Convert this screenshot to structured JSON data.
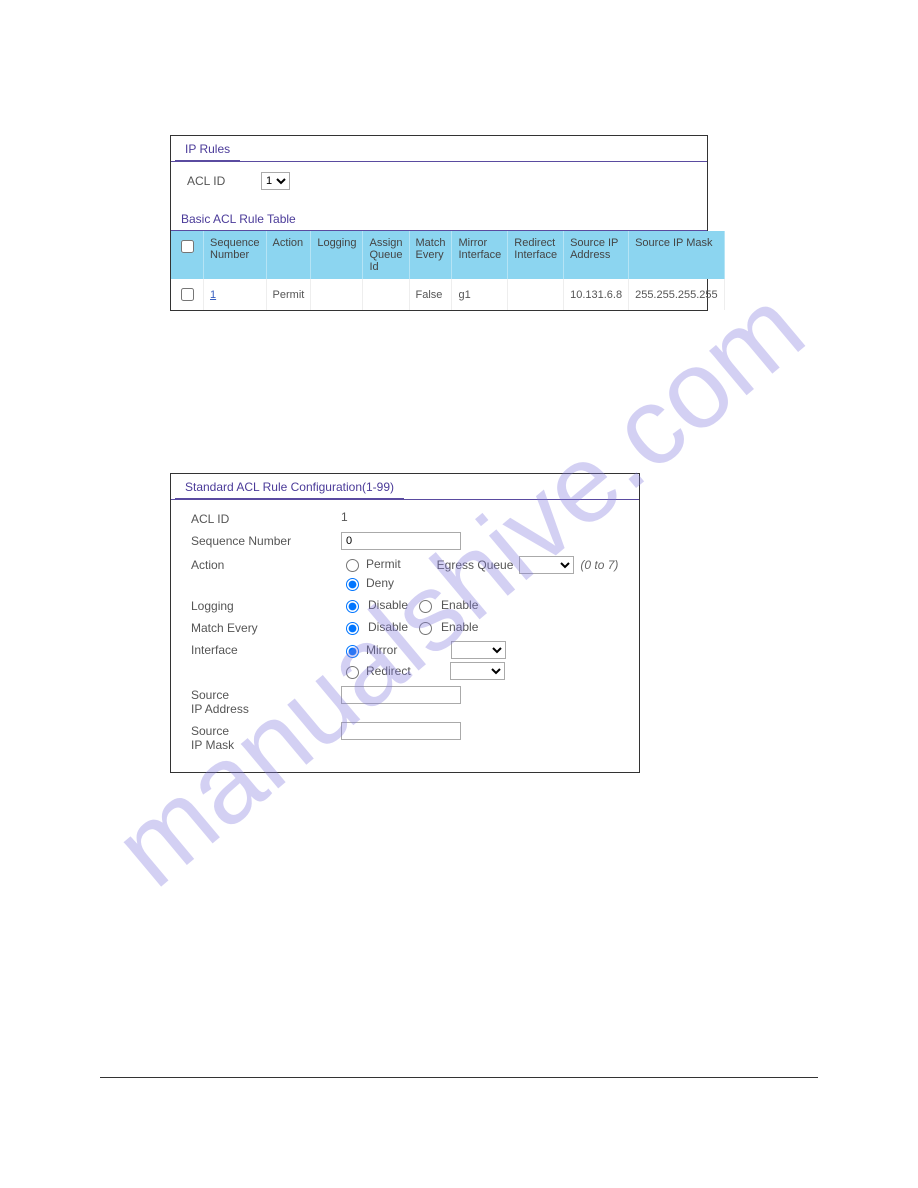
{
  "watermark": "manualshive.com",
  "panel1": {
    "title": "IP Rules",
    "acl_id_label": "ACL ID",
    "acl_id_value": "1",
    "subtitle": "Basic ACL Rule Table",
    "headers": {
      "seq": "Sequence Number",
      "action": "Action",
      "logging": "Logging",
      "assign": "Assign Queue Id",
      "match": "Match Every",
      "mirror": "Mirror Interface",
      "redirect": "Redirect Interface",
      "src_ip": "Source IP Address",
      "src_mask": "Source IP Mask"
    },
    "row": {
      "seq": "1",
      "action": "Permit",
      "logging": "",
      "assign": "",
      "match": "False",
      "mirror": "g1",
      "redirect": "",
      "src_ip": "10.131.6.8",
      "src_mask": "255.255.255.255"
    }
  },
  "panel2": {
    "title": "Standard ACL Rule Configuration(1-99)",
    "acl_id_label": "ACL ID",
    "acl_id_value": "1",
    "seq_label": "Sequence Number",
    "seq_value": "0",
    "action_label": "Action",
    "action_permit": "Permit",
    "action_deny": "Deny",
    "egress_label": "Egress Queue",
    "egress_range": "(0 to 7)",
    "logging_label": "Logging",
    "match_label": "Match Every",
    "opt_disable": "Disable",
    "opt_enable": "Enable",
    "interface_label": "Interface",
    "opt_mirror": "Mirror",
    "opt_redirect": "Redirect",
    "src_ip_label_1": "Source",
    "src_ip_label_2": "IP Address",
    "src_mask_label_1": "Source",
    "src_mask_label_2": "IP Mask"
  }
}
